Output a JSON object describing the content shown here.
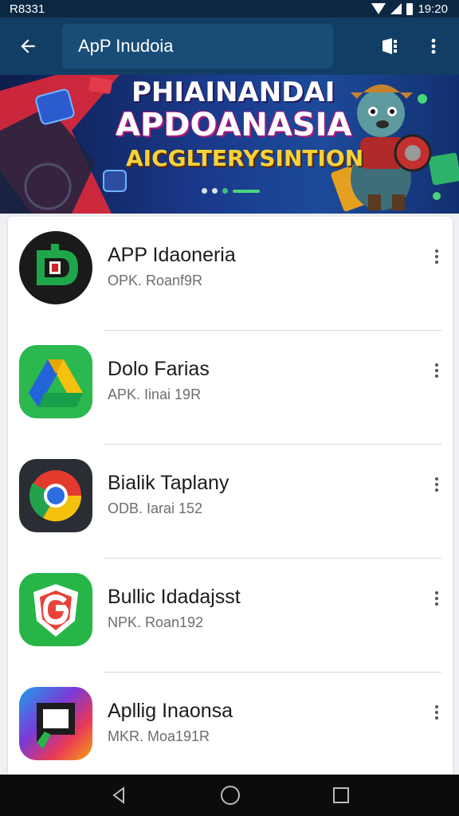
{
  "status_bar": {
    "carrier": "R8331",
    "time": "19:20"
  },
  "app_bar": {
    "title": "ApP Inudoia"
  },
  "banner": {
    "line1": "PHIAINANDAI",
    "line2": "APDOANASIA",
    "line3": "AICGLTERYSINTION"
  },
  "apps": [
    {
      "name": "APP Idaoneria",
      "subtitle": "OPK. Roanf9R",
      "icon": "green-d-app-icon"
    },
    {
      "name": "Dolo Farias",
      "subtitle": "APK. Iinai 19R",
      "icon": "drive-icon"
    },
    {
      "name": "Bialik Taplany",
      "subtitle": "ODB. Iarai 152",
      "icon": "chrome-icon"
    },
    {
      "name": "Bullic Idadajsst",
      "subtitle": "NPK. Roan192",
      "icon": "g-shield-icon"
    },
    {
      "name": "Apllig Inaonsa",
      "subtitle": "MKR. Moa191R",
      "icon": "colorful-square-icon"
    }
  ],
  "colors": {
    "status_bar": "#0b2742",
    "app_bar": "#123e66",
    "nav_bar": "#0c0c0c"
  }
}
